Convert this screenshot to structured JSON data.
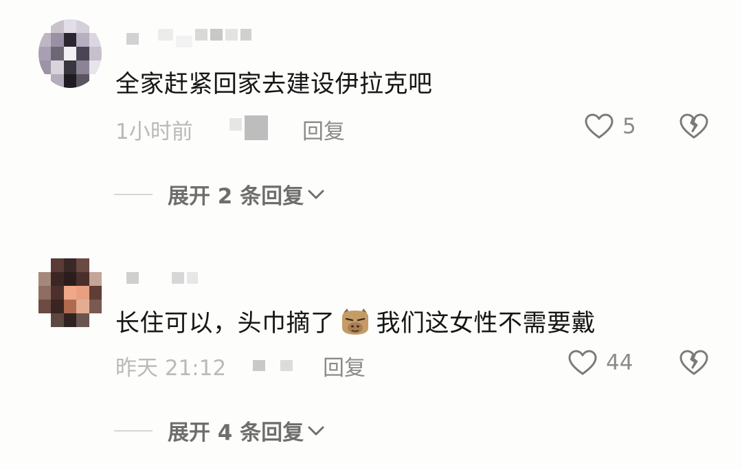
{
  "comments": [
    {
      "text": "全家赶紧回家去建设伊拉克吧",
      "time": "1小时前",
      "reply_label": "回复",
      "likes": "5",
      "expand_label": "展开 2 条回复"
    },
    {
      "text_before": "长住可以，头巾摘了",
      "text_after": "我们这女性不需要戴",
      "emoji": "capybara-face-emoji",
      "time": "昨天 21:12",
      "reply_label": "回复",
      "likes": "44",
      "expand_label": "展开 4 条回复"
    }
  ],
  "colors": {
    "text_primary": "#161616",
    "text_meta": "#b9b9b9",
    "text_action": "#8a8a8a",
    "icon_stroke": "#7a7a7a"
  },
  "icons": {
    "like": "heart-outline-icon",
    "dislike": "broken-heart-icon",
    "expand": "chevron-down-icon"
  }
}
